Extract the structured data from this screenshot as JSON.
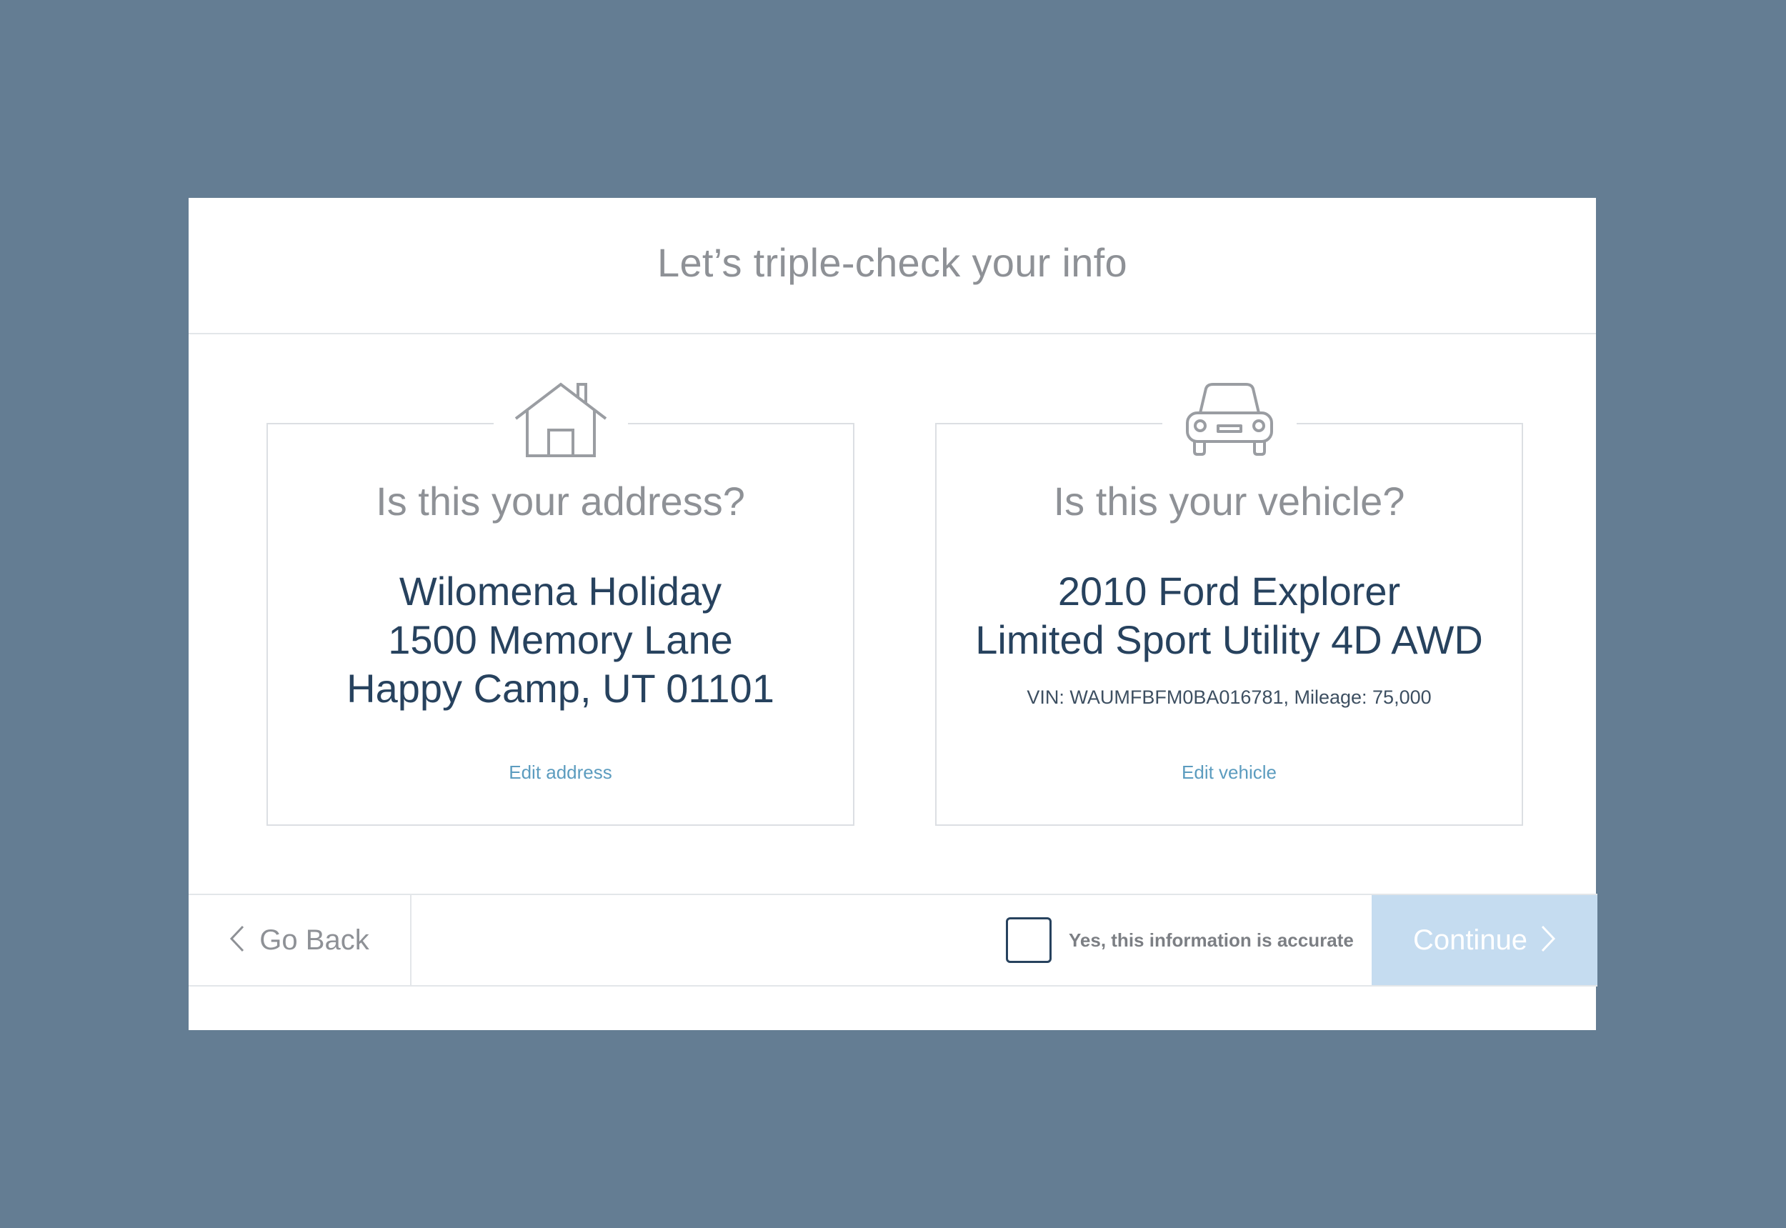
{
  "header": {
    "title": "Let’s triple-check your info"
  },
  "address_card": {
    "icon": "house-icon",
    "question": "Is this your address?",
    "lines": [
      "Wilomena Holiday",
      "1500 Memory Lane",
      "Happy Camp, UT 01101"
    ],
    "edit_label": "Edit address"
  },
  "vehicle_card": {
    "icon": "car-icon",
    "question": "Is this your vehicle?",
    "lines": [
      "2010 Ford Explorer",
      "Limited Sport Utility 4D AWD"
    ],
    "details": "VIN: WAUMFBFM0BA016781, Mileage: 75,000",
    "edit_label": "Edit vehicle"
  },
  "footer": {
    "back_label": "Go Back",
    "back_icon": "chevron-left-icon",
    "confirm_label": "Yes, this information is accurate",
    "confirm_checked": false,
    "continue_label": "Continue",
    "continue_icon": "chevron-right-icon"
  },
  "colors": {
    "background": "#647d93",
    "accent_link": "#5c9cbf",
    "primary_text": "#27425e",
    "muted_text": "#8e9196",
    "continue_disabled": "#c5dcf0"
  }
}
